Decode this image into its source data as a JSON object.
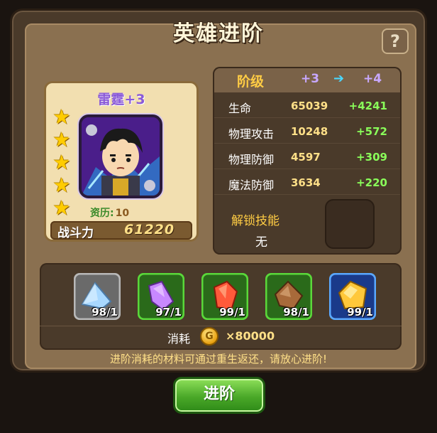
{
  "title": "英雄进阶",
  "help_label": "?",
  "hero": {
    "name": "雷霆+3",
    "stars": 5,
    "qualification_label": "资历:",
    "qualification_value": "10",
    "power_label": "战斗力",
    "power_value": "61220"
  },
  "stats": {
    "header_label": "阶级",
    "current_rank": "+3",
    "next_rank": "+4",
    "rows": [
      {
        "name": "生命",
        "value": "65039",
        "increase": "+4241"
      },
      {
        "name": "物理攻击",
        "value": "10248",
        "increase": "+572"
      },
      {
        "name": "物理防御",
        "value": "4597",
        "increase": "+309"
      },
      {
        "name": "魔法防御",
        "value": "3634",
        "increase": "+220"
      }
    ],
    "unlock_label": "解锁技能",
    "unlock_value": "无"
  },
  "materials": [
    {
      "name": "blue-crystal",
      "count": "98/1",
      "border": "#b8b8b8",
      "bg": "#6a6a6a",
      "gem": "#a8d8ff"
    },
    {
      "name": "purple-crystal",
      "count": "97/1",
      "border": "#5ad83a",
      "bg": "#2a6a1a",
      "gem": "#c888ff"
    },
    {
      "name": "red-crystal",
      "count": "99/1",
      "border": "#5ad83a",
      "bg": "#2a6a1a",
      "gem": "#ff5a3a"
    },
    {
      "name": "brown-crystal",
      "count": "98/1",
      "border": "#5ad83a",
      "bg": "#2a6a1a",
      "gem": "#a86a3a"
    },
    {
      "name": "gold-crystal",
      "count": "99/1",
      "border": "#5aa8ff",
      "bg": "#1a3a8a",
      "gem": "#ffc83a"
    }
  ],
  "cost": {
    "label": "消耗",
    "value": "×80000"
  },
  "notice": "进阶消耗的材料可通过重生返还，请放心进阶!",
  "advance_button": "进阶",
  "arrow": "➔"
}
